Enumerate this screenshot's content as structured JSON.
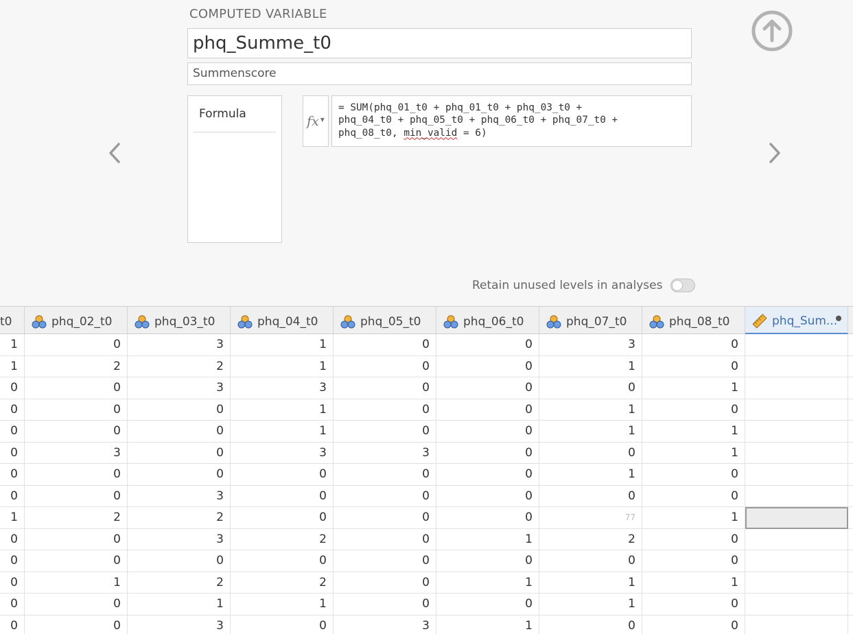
{
  "panel": {
    "kind_label": "COMPUTED VARIABLE",
    "name": "phq_Summe_t0",
    "description": "Summenscore",
    "formula_tab_label": "Formula",
    "fx_label": "fx",
    "formula_lines": [
      "= SUM(phq_01_t0 + phq_01_t0 + phq_03_t0 +",
      "phq_04_t0 + phq_05_t0 + phq_06_t0 + phq_07_t0 +",
      "phq_08_t0, ",
      "min_valid",
      " = 6)"
    ],
    "retain_label": "Retain unused levels in analyses",
    "retain_enabled": false
  },
  "grid": {
    "columns": [
      {
        "label": "t0",
        "icon": "nominal-variable-icon",
        "partial": true
      },
      {
        "label": "phq_02_t0",
        "icon": "nominal-variable-icon"
      },
      {
        "label": "phq_03_t0",
        "icon": "nominal-variable-icon"
      },
      {
        "label": "phq_04_t0",
        "icon": "nominal-variable-icon"
      },
      {
        "label": "phq_05_t0",
        "icon": "nominal-variable-icon"
      },
      {
        "label": "phq_06_t0",
        "icon": "nominal-variable-icon"
      },
      {
        "label": "phq_07_t0",
        "icon": "nominal-variable-icon"
      },
      {
        "label": "phq_08_t0",
        "icon": "nominal-variable-icon"
      },
      {
        "label": "phq_Sum...",
        "icon": "continuous-ruler-icon",
        "selected": true
      }
    ],
    "rows": [
      [
        "1",
        "0",
        "3",
        "1",
        "0",
        "0",
        "3",
        "0",
        ""
      ],
      [
        "1",
        "2",
        "2",
        "1",
        "0",
        "0",
        "1",
        "0",
        ""
      ],
      [
        "0",
        "0",
        "3",
        "3",
        "0",
        "0",
        "0",
        "1",
        ""
      ],
      [
        "0",
        "0",
        "0",
        "1",
        "0",
        "0",
        "1",
        "0",
        ""
      ],
      [
        "0",
        "0",
        "0",
        "1",
        "0",
        "0",
        "1",
        "1",
        ""
      ],
      [
        "0",
        "3",
        "0",
        "3",
        "3",
        "0",
        "0",
        "1",
        ""
      ],
      [
        "0",
        "0",
        "0",
        "0",
        "0",
        "0",
        "1",
        "0",
        ""
      ],
      [
        "0",
        "0",
        "3",
        "0",
        "0",
        "0",
        "0",
        "0",
        ""
      ],
      [
        "1",
        "2",
        "2",
        "0",
        "0",
        "0",
        "77",
        "1",
        ""
      ],
      [
        "0",
        "0",
        "3",
        "2",
        "0",
        "1",
        "2",
        "0",
        ""
      ],
      [
        "0",
        "0",
        "0",
        "0",
        "0",
        "0",
        "0",
        "0",
        ""
      ],
      [
        "0",
        "1",
        "2",
        "2",
        "0",
        "1",
        "1",
        "1",
        ""
      ],
      [
        "0",
        "0",
        "1",
        "1",
        "0",
        "0",
        "1",
        "0",
        ""
      ],
      [
        "0",
        "0",
        "3",
        "0",
        "3",
        "1",
        "0",
        "0",
        ""
      ]
    ],
    "missing_value_cell": {
      "row": 8,
      "col": 6
    },
    "active_cell": {
      "row": 8,
      "col": 8
    }
  },
  "colors": {
    "accent": "#3f6fae",
    "nominal_icon_orange": "#f2b33d",
    "nominal_icon_blue": "#6d9be0"
  }
}
